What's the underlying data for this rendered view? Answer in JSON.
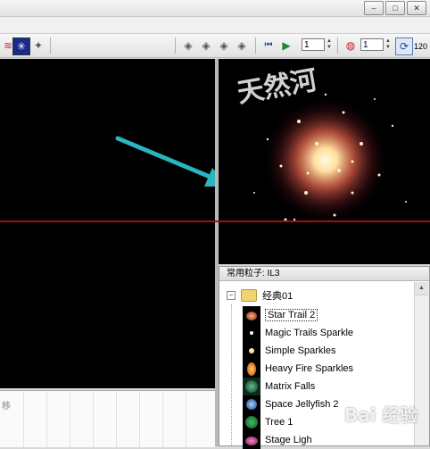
{
  "toolbar": {
    "frame_value": "1",
    "emit_value": "1",
    "fps_value": "120"
  },
  "library": {
    "title": "常用粒子: IL3",
    "folder": "经典01",
    "items": [
      {
        "label": "Star Trail 2",
        "icon": "star-trail-thumb"
      },
      {
        "label": "Magic Trails Sparkle",
        "icon": "sparkle-thumb"
      },
      {
        "label": "Simple Sparkles",
        "icon": "sparkle-thumb"
      },
      {
        "label": "Heavy Fire Sparkles",
        "icon": "fire-thumb"
      },
      {
        "label": "Matrix Falls",
        "icon": "matrix-thumb"
      },
      {
        "label": "Space Jellyfish 2",
        "icon": "jellyfish-thumb"
      },
      {
        "label": "Tree 1",
        "icon": "tree-thumb"
      },
      {
        "label": "Stage Ligh",
        "icon": "stage-thumb"
      }
    ]
  },
  "timeline": {
    "label": "移"
  },
  "watermarks": {
    "top": "天然河",
    "bottom": "Bai 经验"
  },
  "colors": {
    "arrow": "#2ab5c0",
    "guide_line": "#a01010",
    "preview_glow": "#ff9a6a"
  }
}
